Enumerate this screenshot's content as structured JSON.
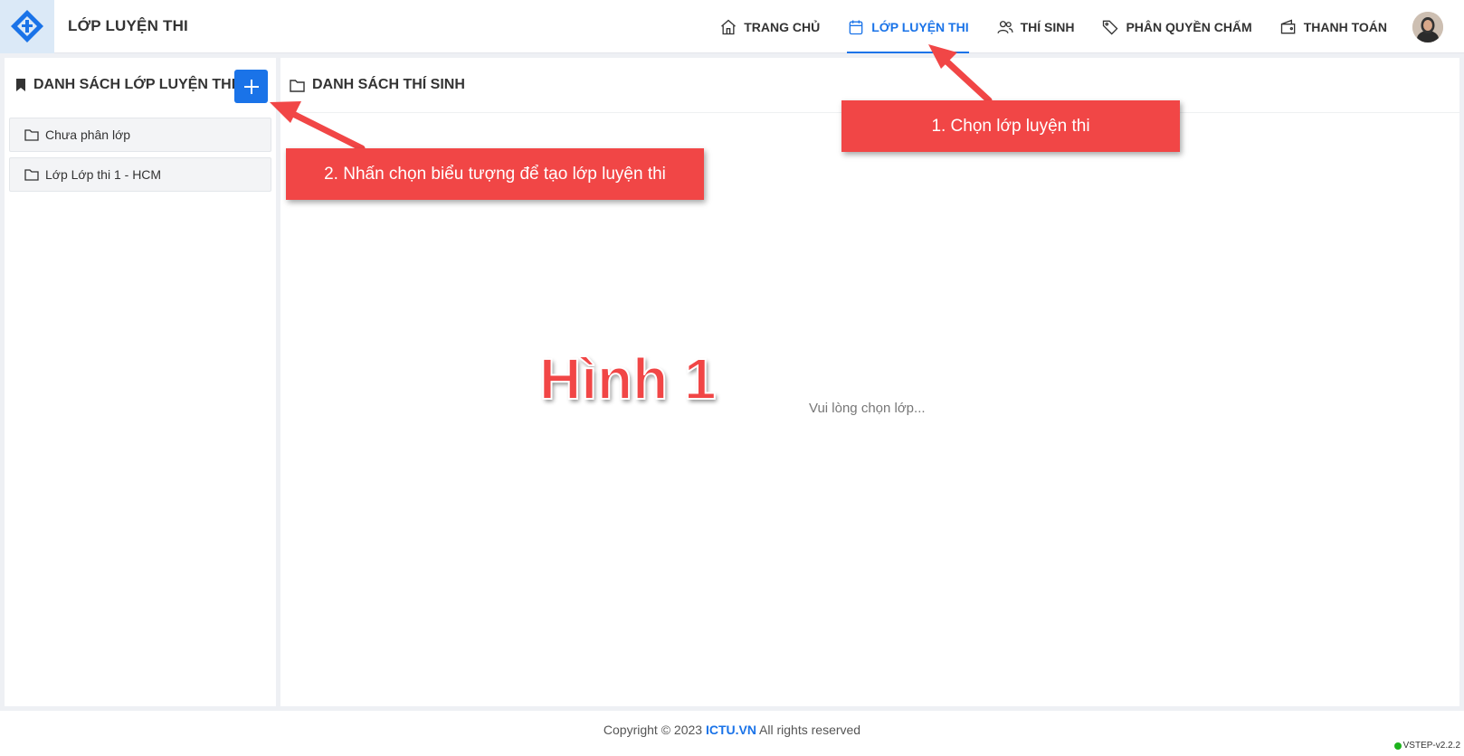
{
  "header": {
    "app_title": "LỚP LUYỆN THI",
    "nav": [
      {
        "label": "TRANG CHỦ",
        "icon": "home-icon"
      },
      {
        "label": "LỚP LUYỆN THI",
        "icon": "calendar-icon",
        "active": true
      },
      {
        "label": "THÍ SINH",
        "icon": "users-icon"
      },
      {
        "label": "PHÂN QUYỀN CHẤM",
        "icon": "tag-icon"
      },
      {
        "label": "THANH TOÁN",
        "icon": "wallet-icon"
      }
    ]
  },
  "left_panel": {
    "title": "DANH SÁCH LỚP LUYỆN THI",
    "items": [
      "Chưa phân lớp",
      "Lớp Lớp thi 1 - HCM"
    ]
  },
  "right_panel": {
    "title": "DANH SÁCH THÍ SINH",
    "empty_message": "Vui lòng chọn lớp..."
  },
  "footer": {
    "copyright_prefix": "Copyright © 2023 ",
    "brand": "ICTU.VN",
    "copyright_suffix": " All rights reserved",
    "version": "VSTEP-v2.2.2"
  },
  "annotations": {
    "callout_1": "1. Chọn lớp luyện thi",
    "callout_2": "2. Nhấn chọn biểu tượng để tạo lớp luyện thi",
    "figure_label": "Hình 1"
  },
  "colors": {
    "accent": "#1a73e8",
    "annotation": "#f14646"
  }
}
